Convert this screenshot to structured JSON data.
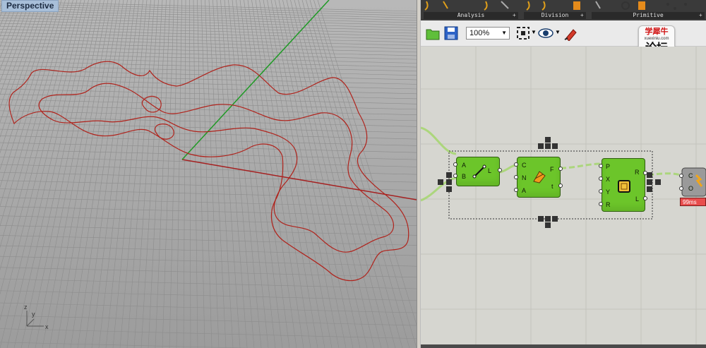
{
  "viewport": {
    "label": "Perspective",
    "axes": {
      "x": "x",
      "y": "y",
      "z": "z"
    }
  },
  "gh": {
    "ribbon": {
      "groups": [
        {
          "title": "Analysis"
        },
        {
          "title": "Division"
        },
        {
          "title": "Primitive"
        }
      ]
    },
    "toolbar": {
      "zoom": "100%",
      "icons": [
        "open-file-icon",
        "save-icon",
        "zoom-extents-icon",
        "preview-eye-icon",
        "sketch-pen-icon"
      ]
    },
    "logo": {
      "line1": "学犀牛",
      "line2": "xuexiniu.com",
      "line3": "论坛"
    },
    "components": {
      "line": {
        "inputs": [
          "A",
          "B"
        ],
        "outputs": [
          "L"
        ]
      },
      "divide": {
        "inputs": [
          "C",
          "N",
          "A"
        ],
        "outputs": [
          "F",
          "t"
        ]
      },
      "rect": {
        "inputs": [
          "P",
          "X",
          "Y",
          "R"
        ],
        "outputs": [
          "R",
          "L"
        ]
      },
      "last": {
        "inputs": [
          "C",
          "O"
        ]
      }
    },
    "timer": "99ms"
  }
}
